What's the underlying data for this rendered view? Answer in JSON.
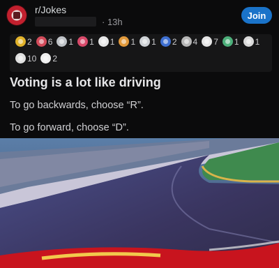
{
  "subreddit": {
    "name": "r/Jokes",
    "age": "· 13h",
    "join_label": "Join"
  },
  "awards": {
    "row1": [
      {
        "icon": "gold-medal-icon",
        "color": "#e2b32b",
        "count": "2"
      },
      {
        "icon": "wholesome-icon",
        "color": "#d24b5a",
        "count": "6"
      },
      {
        "icon": "helpful-icon",
        "color": "#bfc3c7",
        "count": "1"
      },
      {
        "icon": "heart-icon",
        "color": "#d84a6a",
        "count": "1"
      },
      {
        "icon": "snoo-icon",
        "color": "#e6e6e6",
        "count": "1"
      },
      {
        "icon": "laughing-icon",
        "color": "#e29a3c",
        "count": "1"
      },
      {
        "icon": "party-icon",
        "color": "#cfd2d6",
        "count": "1"
      },
      {
        "icon": "flag-icon",
        "color": "#3e6fd1",
        "count": "2"
      },
      {
        "icon": "handshake-icon",
        "color": "#b6b6b6",
        "count": "4"
      },
      {
        "icon": "wink-icon",
        "color": "#e5e5e5",
        "count": "7"
      },
      {
        "icon": "rocket-icon",
        "color": "#4caf7a",
        "count": "1"
      },
      {
        "icon": "unicorn-icon",
        "color": "#d9d9d9",
        "count": "1"
      }
    ],
    "row2": [
      {
        "icon": "silver-icon",
        "color": "#e0e0e0",
        "count": "10"
      },
      {
        "icon": "face-icon",
        "color": "#f0f0f0",
        "count": "2"
      }
    ]
  },
  "post": {
    "title": "Voting is a lot like driving",
    "line1": "To go backwards, choose “R”.",
    "line2": "To go forward, choose “D”."
  }
}
